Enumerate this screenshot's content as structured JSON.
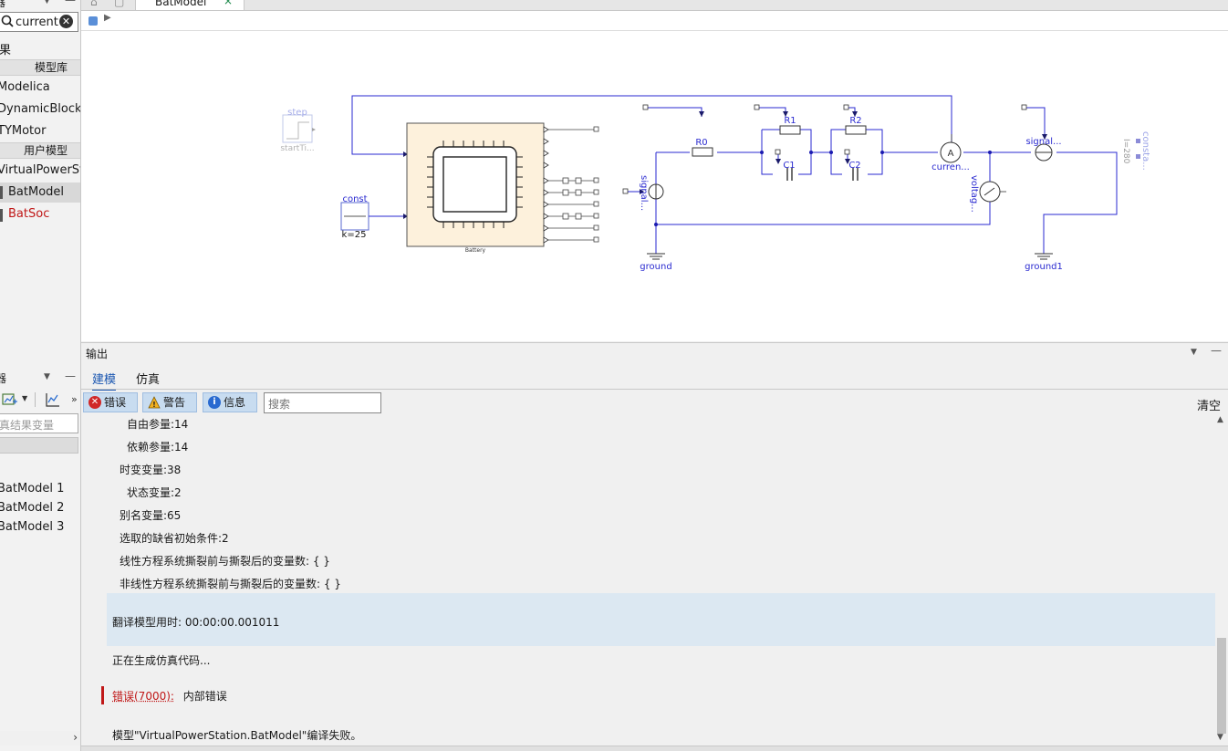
{
  "left_panel": {
    "top_title": "器",
    "search_value": "current",
    "results_label": "果",
    "section_library": "模型库",
    "library_items": [
      "Modelica",
      "DynamicBlocks",
      "TYMotor"
    ],
    "section_user": "用户模型",
    "user_items": [
      "VirtualPowerStation",
      "BatModel",
      "BatSoc"
    ],
    "vars_title": "器",
    "vars_search_placeholder": "真结果变量",
    "results": [
      "BatModel 1",
      "BatModel 2",
      "BatModel 3"
    ]
  },
  "tab": {
    "title": "BatModel",
    "close": "×"
  },
  "diagram": {
    "step": "step",
    "step_param": "startTi...",
    "const": "const",
    "const_param": "k=25",
    "battery": "Battery",
    "r0": "R0",
    "r1": "R1",
    "r2": "R2",
    "c1": "C1",
    "c2": "C2",
    "signal_v": "signal...",
    "current": "curren...",
    "voltage": "voltag...",
    "signal_c": "signal...",
    "constant": "consta...",
    "constant_param": "I=280",
    "ground": "ground",
    "ground1": "ground1"
  },
  "output": {
    "title": "输出",
    "tabs": [
      "建模",
      "仿真"
    ],
    "filters": {
      "error": "错误",
      "warning": "警告",
      "info": "信息"
    },
    "search_placeholder": "搜索",
    "clear": "清空",
    "lines": {
      "free_params": "自由参量:14",
      "dep_params": "依赖参量:14",
      "time_vars": "时变变量:38",
      "state_vars": "状态变量:2",
      "alias_vars": "别名变量:65",
      "init_cond": "选取的缺省初始条件:2",
      "linear": "线性方程系统撕裂前与撕裂后的变量数: { }",
      "nonlinear": "非线性方程系统撕裂前与撕裂后的变量数: { }",
      "translate_time": "翻译模型用时: 00:00:00.001011",
      "generating": "正在生成仿真代码...",
      "err_code": "错误(7000):",
      "err_msg": "内部错误",
      "fail": "模型\"VirtualPowerStation.BatModel\"编译失败。"
    }
  }
}
